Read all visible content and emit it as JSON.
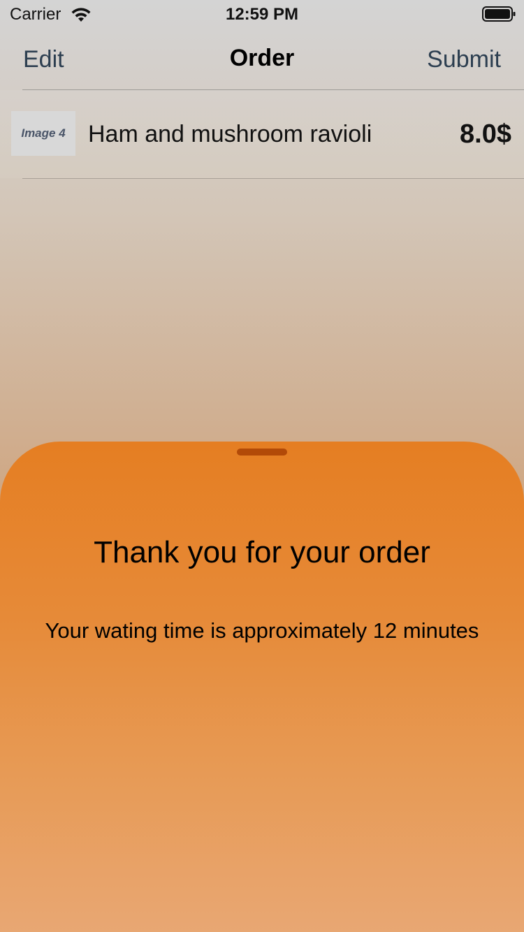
{
  "status_bar": {
    "carrier": "Carrier",
    "time": "12:59 PM",
    "wifi_icon": "wifi-icon",
    "battery_icon": "battery-icon"
  },
  "nav": {
    "left_label": "Edit",
    "title": "Order",
    "right_label": "Submit"
  },
  "order": {
    "items": [
      {
        "thumbnail_label": "Image 4",
        "name": "Ham and mushroom ravioli",
        "price": "8.0$"
      }
    ]
  },
  "sheet": {
    "title": "Thank you for your order",
    "message": "Your wating time is approximately 12 minutes"
  },
  "colors": {
    "sheet_orange": "#e57e22",
    "grabber": "#b24a08",
    "nav_text": "#2c3e50"
  }
}
